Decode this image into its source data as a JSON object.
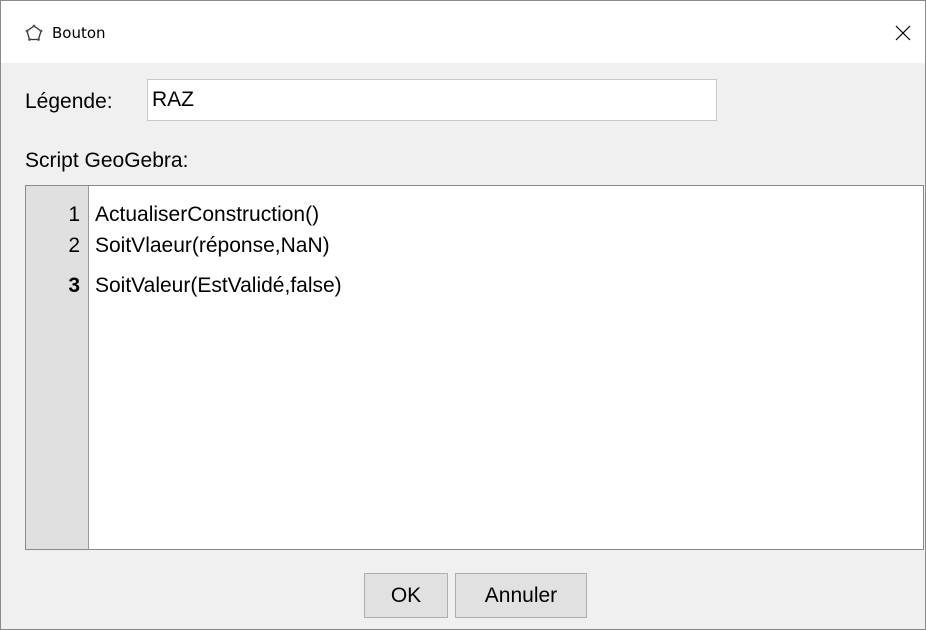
{
  "window": {
    "title": "Bouton",
    "title_icon": "pentagon-icon",
    "close_icon": "close-icon"
  },
  "caption": {
    "label": "Légende:",
    "value": "RAZ"
  },
  "script": {
    "label": "Script GeoGebra:",
    "current_line": 3,
    "lines": [
      {
        "number": "1",
        "code": "ActualiserConstruction()"
      },
      {
        "number": "2",
        "code": "SoitVlaeur(réponse,NaN)"
      },
      {
        "number": "3",
        "code": "SoitValeur(EstValidé,false)"
      }
    ]
  },
  "buttons": {
    "ok_label": "OK",
    "cancel_label": "Annuler"
  },
  "colors": {
    "titlebar_bg": "#ffffff",
    "dialog_bg": "#f0f0f0",
    "gutter_bg": "#e0e0e0",
    "button_bg": "#e1e1e1"
  }
}
